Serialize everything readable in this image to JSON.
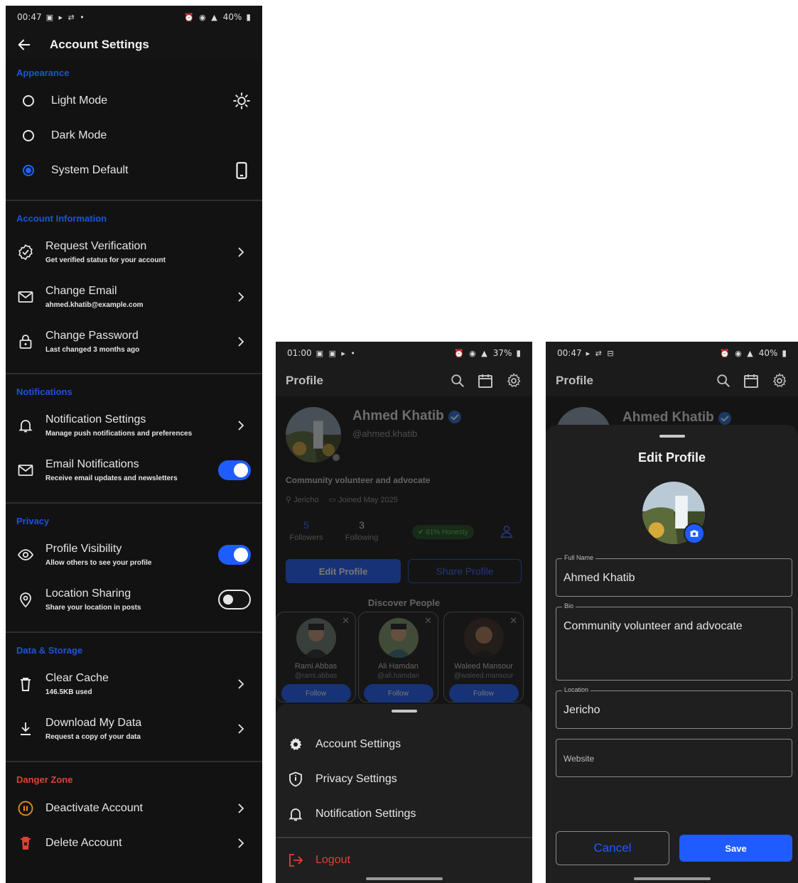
{
  "screen1": {
    "status_time": "00:47",
    "status_battery": "40%",
    "title": "Account Settings",
    "appearance": {
      "header": "Appearance",
      "options": [
        {
          "label": "Light Mode",
          "selected": false,
          "icon": "sun-icon"
        },
        {
          "label": "Dark Mode",
          "selected": false,
          "icon": "moon-icon"
        },
        {
          "label": "System Default",
          "selected": true,
          "icon": "phone-icon"
        }
      ]
    },
    "account": {
      "header": "Account Information",
      "items": [
        {
          "title": "Request Verification",
          "subtitle": "Get verified status for your account",
          "icon": "verified-badge-icon"
        },
        {
          "title": "Change Email",
          "subtitle": "ahmed.khatib@example.com",
          "icon": "mail-icon"
        },
        {
          "title": "Change Password",
          "subtitle": "Last changed 3 months ago",
          "icon": "lock-icon"
        }
      ]
    },
    "notifications": {
      "header": "Notifications",
      "items": [
        {
          "title": "Notification Settings",
          "subtitle": "Manage push notifications and preferences",
          "icon": "bell-icon"
        },
        {
          "title": "Email Notifications",
          "subtitle": "Receive email updates and newsletters",
          "icon": "mail-icon",
          "toggle": true
        }
      ]
    },
    "privacy": {
      "header": "Privacy",
      "items": [
        {
          "title": "Profile Visibility",
          "subtitle": "Allow others to see your profile",
          "icon": "eye-icon",
          "toggle": true
        },
        {
          "title": "Location Sharing",
          "subtitle": "Share your location in posts",
          "icon": "location-pin-icon",
          "toggle": false
        }
      ]
    },
    "storage": {
      "header": "Data & Storage",
      "items": [
        {
          "title": "Clear Cache",
          "subtitle": "146.5KB used",
          "icon": "trash-icon"
        },
        {
          "title": "Download My Data",
          "subtitle": "Request a copy of your data",
          "icon": "download-icon"
        }
      ]
    },
    "danger": {
      "header": "Danger Zone",
      "items": [
        {
          "title": "Deactivate Account",
          "icon": "pause-circle-icon"
        },
        {
          "title": "Delete Account",
          "icon": "delete-icon"
        }
      ]
    }
  },
  "screen2": {
    "status_time": "01:00",
    "status_battery": "37%",
    "title": "Profile",
    "name": "Ahmed Khatib",
    "handle": "@ahmed.khatib",
    "bio": "Community volunteer and advocate",
    "location": "Jericho",
    "joined": "Joined May 2025",
    "followers_count": "5",
    "followers_label": "Followers",
    "following_count": "3",
    "following_label": "Following",
    "honesty_badge": "81% Honesty",
    "edit_button": "Edit Profile",
    "share_button": "Share Profile",
    "discover_title": "Discover People",
    "people": [
      {
        "name": "Rami Abbas",
        "handle": "@rami.abbas",
        "follow": "Follow"
      },
      {
        "name": "Ali Hamdan",
        "handle": "@ali.hamdan",
        "follow": "Follow"
      },
      {
        "name": "Waleed Mansour",
        "handle": "@waleed.mansour",
        "follow": "Follow"
      }
    ],
    "menu": [
      "Account Settings",
      "Privacy Settings",
      "Notification Settings"
    ],
    "logout": "Logout"
  },
  "screen3": {
    "status_time": "00:47",
    "status_battery": "40%",
    "title": "Profile",
    "name": "Ahmed Khatib",
    "sheet_title": "Edit Profile",
    "fields": {
      "full_name_label": "Full Name",
      "full_name_value": "Ahmed Khatib",
      "bio_label": "Bio",
      "bio_value": "Community volunteer and advocate",
      "location_label": "Location",
      "location_value": "Jericho",
      "website_placeholder": "Website"
    },
    "cancel": "Cancel",
    "save": "Save"
  },
  "colors": {
    "accent": "#1f5cff",
    "section_header": "#1e53d8",
    "danger": "#e04134",
    "background": "#141414"
  }
}
